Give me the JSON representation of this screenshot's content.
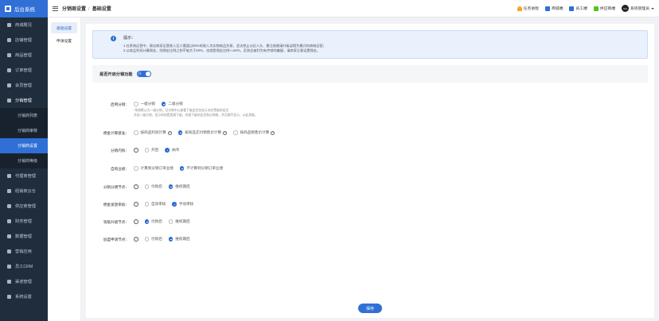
{
  "sidebar": {
    "brand": "后台系统",
    "items": [
      {
        "label": "商城概况",
        "icon": "home-icon"
      },
      {
        "label": "店铺管理",
        "icon": "shop-icon"
      },
      {
        "label": "商品管理",
        "icon": "goods-icon"
      },
      {
        "label": "订单管理",
        "icon": "order-icon"
      },
      {
        "label": "会员管理",
        "icon": "member-icon"
      },
      {
        "label": "分销管理",
        "icon": "distribution-icon"
      }
    ],
    "sub_items": [
      {
        "label": "分销商列表"
      },
      {
        "label": "分销商审核"
      },
      {
        "label": "分销商设置"
      },
      {
        "label": "分销商等级"
      }
    ],
    "items_after": [
      {
        "label": "代理商管理",
        "icon": "agent-icon"
      },
      {
        "label": "经销商云仓",
        "icon": "warehouse-icon"
      },
      {
        "label": "供应商管理",
        "icon": "supplier-icon"
      },
      {
        "label": "财务管理",
        "icon": "finance-icon"
      },
      {
        "label": "数据管理",
        "icon": "data-icon"
      },
      {
        "label": "营销应用",
        "icon": "marketing-icon"
      },
      {
        "label": "员工CRM",
        "icon": "crm-icon"
      },
      {
        "label": "渠道管理",
        "icon": "channel-icon"
      },
      {
        "label": "系统设置",
        "icon": "settings-icon"
      }
    ]
  },
  "header": {
    "breadcrumb_parent": "分销商设置",
    "breadcrumb_sep": "/",
    "breadcrumb_current": "基础设置",
    "links": [
      {
        "label": "任务进程",
        "icon": "bell-icon"
      },
      {
        "label": "商城端",
        "icon": "mall-icon"
      },
      {
        "label": "员工端",
        "icon": "staff-icon"
      },
      {
        "label": "供应商端",
        "icon": "supplier-icon"
      }
    ],
    "avatar_text": "GO",
    "user_name": "系统管理员"
  },
  "subnav": {
    "items": [
      {
        "label": "基础设置"
      },
      {
        "label": "申请设置"
      }
    ]
  },
  "tip": {
    "icon": "info-icon",
    "title": "提示：",
    "lines": [
      "1.在系统运营中，建议商家运营收入至少要超过80%的收入为实物商品交易，坚决禁止以拉人头、靠注册邀请升级返佣为模式的商城运营；",
      "2.以商品利润计算佣金，则佣金比例之和不能大于50%，也就是佣金比例<=50%，否则会被判为有传销的嫌疑，请商家注意设置佣金。"
    ]
  },
  "switch": {
    "label": "是否开启分销功能",
    "on_text": "开"
  },
  "form": {
    "level": {
      "label": "启用分销：",
      "options": [
        "一级分销",
        "二级分销"
      ],
      "note": [
        "*系统默认为一级分销，且分销中心查看下级会员仅显示对应等级的会员",
        "开启二级分销，显示的则是直属下级，间接下级的会员和分销商，并且都不显示，以此类推。"
      ]
    },
    "commission_base": {
      "label": "佣金计算基准：",
      "options": [
        "按商品利润计算",
        "按商品实付销售价计算",
        "按商品销售价计算"
      ]
    },
    "self_buy": {
      "label": "分销内购：",
      "options": [
        "开启",
        "关闭"
      ]
    },
    "performance": {
      "label": "自购业绩：",
      "options": [
        "计算到分销订单业绩",
        "不计算到分销订单业绩"
      ]
    },
    "distribution_node": {
      "label": "分销分佣节点：",
      "options": [
        "付款后",
        "维权期后"
      ]
    },
    "commission_review": {
      "label": "佣金发放审核：",
      "options": [
        "自动审核",
        "手动审核"
      ]
    },
    "upgrade_node": {
      "label": "等级升级节点：",
      "options": [
        "付款后",
        "维权期后"
      ]
    },
    "join_node": {
      "label": "加盟申请节点：",
      "options": [
        "付款后",
        "维权期后"
      ]
    }
  },
  "save_label": "保存"
}
